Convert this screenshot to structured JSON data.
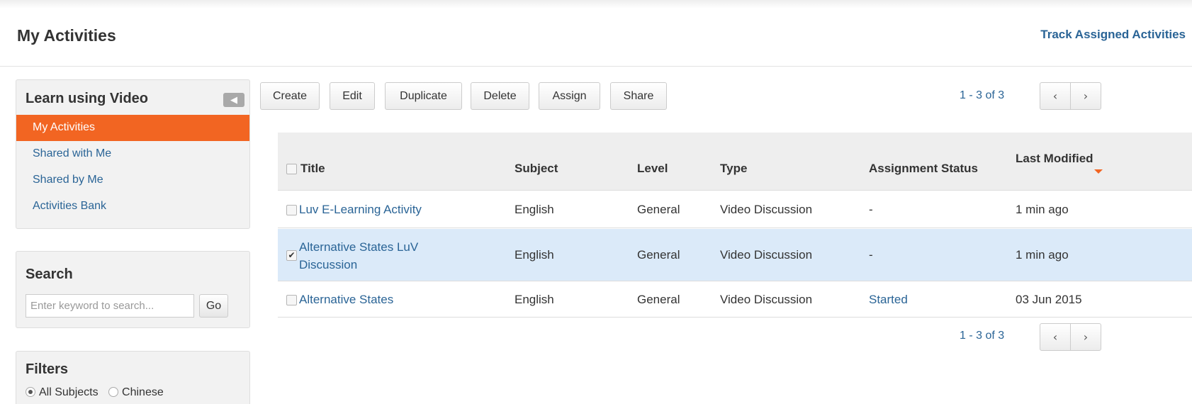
{
  "header": {
    "title": "My Activities",
    "track_link": "Track Assigned Activities"
  },
  "sidebar": {
    "nav": {
      "title": "Learn using Video",
      "collapse_icon": "chevron-left-icon",
      "items": [
        {
          "label": "My Activities",
          "active": true
        },
        {
          "label": "Shared with Me",
          "active": false
        },
        {
          "label": "Shared by Me",
          "active": false
        },
        {
          "label": "Activities Bank",
          "active": false
        }
      ]
    },
    "search": {
      "title": "Search",
      "placeholder": "Enter keyword to search...",
      "value": "",
      "go_label": "Go"
    },
    "filters": {
      "title": "Filters",
      "options": [
        {
          "label": "All Subjects",
          "checked": true
        },
        {
          "label": "Chinese",
          "checked": false
        }
      ]
    }
  },
  "toolbar": {
    "create": "Create",
    "edit": "Edit",
    "duplicate": "Duplicate",
    "delete": "Delete",
    "assign": "Assign",
    "share": "Share"
  },
  "pagination": {
    "range": "1 - 3 of 3",
    "prev_icon": "chevron-left-icon",
    "next_icon": "chevron-right-icon",
    "prev_glyph": "‹",
    "next_glyph": "›"
  },
  "table": {
    "columns": {
      "title": "Title",
      "subject": "Subject",
      "level": "Level",
      "type": "Type",
      "status": "Assignment Status",
      "modified": "Last Modified"
    },
    "sort": {
      "column": "Last Modified",
      "direction": "descending"
    },
    "rows": [
      {
        "checked": false,
        "title": "Luv E-Learning Activity",
        "subject": "English",
        "level": "General",
        "type": "Video Discussion",
        "status": "-",
        "modified": "1 min ago"
      },
      {
        "checked": true,
        "title": "Alternative States LuV Discussion",
        "subject": "English",
        "level": "General",
        "type": "Video Discussion",
        "status": "-",
        "modified": "1 min ago"
      },
      {
        "checked": false,
        "title": "Alternative States",
        "subject": "English",
        "level": "General",
        "type": "Video Discussion",
        "status": "Started",
        "modified": "03 Jun 2015"
      }
    ]
  },
  "colors": {
    "accent": "#f26522",
    "link": "#2a6496",
    "selected_row": "#dbeaf9"
  }
}
